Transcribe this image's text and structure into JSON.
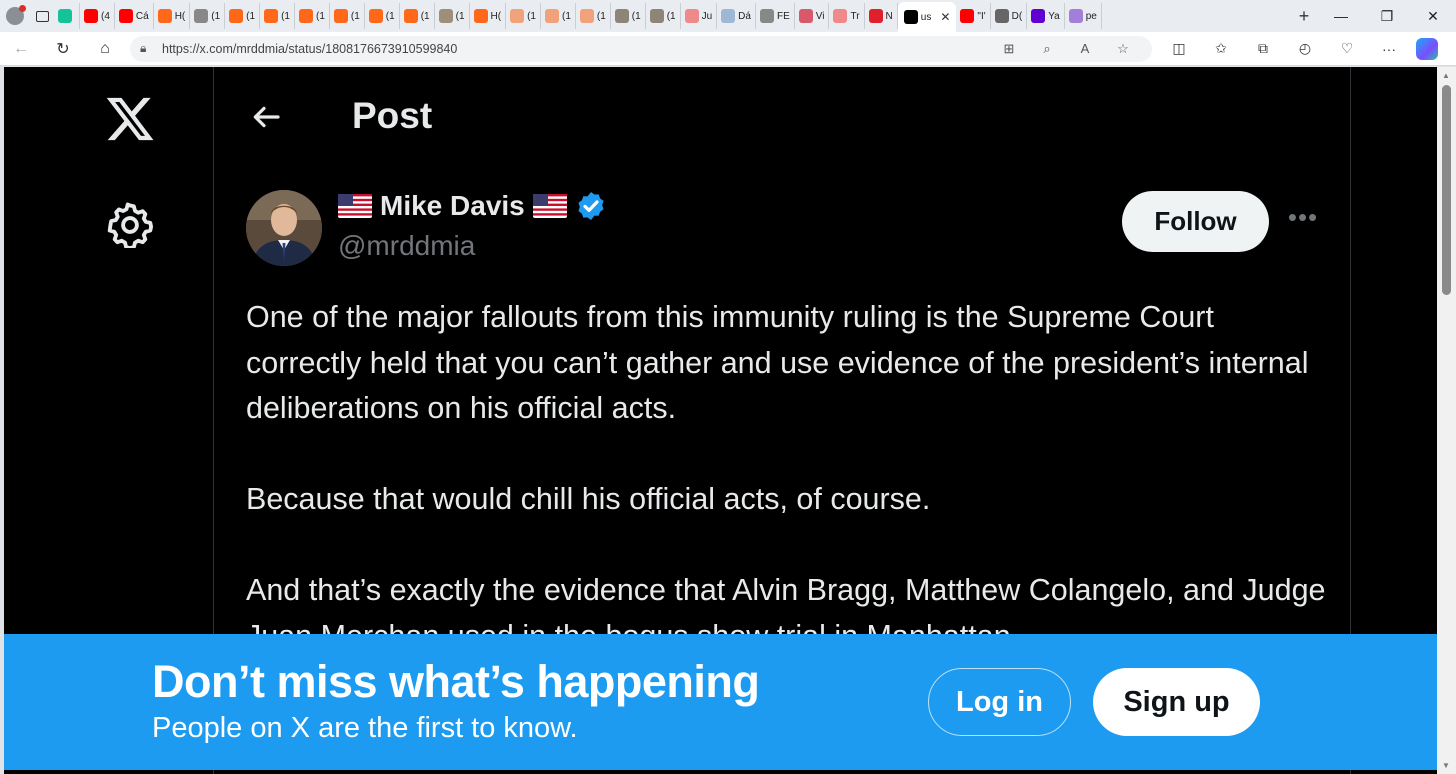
{
  "browser": {
    "tabs": [
      {
        "label": "",
        "icon": "grammarly-icon",
        "color": "#15c39a"
      },
      {
        "label": "(4",
        "icon": "youtube-icon",
        "color": "#ff0000"
      },
      {
        "label": "Cá",
        "icon": "youtube-icon",
        "color": "#ff0000"
      },
      {
        "label": "H(",
        "icon": "substack-icon",
        "color": "#ff6719"
      },
      {
        "label": "(1",
        "icon": "page-icon",
        "color": "#888888"
      },
      {
        "label": "(1",
        "icon": "substack-icon",
        "color": "#ff6719"
      },
      {
        "label": "(1",
        "icon": "substack-icon",
        "color": "#ff6719"
      },
      {
        "label": "(1",
        "icon": "substack-icon",
        "color": "#ff6719"
      },
      {
        "label": "(1",
        "icon": "substack-icon",
        "color": "#ff6719"
      },
      {
        "label": "(1",
        "icon": "substack-icon",
        "color": "#ff6719"
      },
      {
        "label": "(1",
        "icon": "substack-icon",
        "color": "#ff6719"
      },
      {
        "label": "(1",
        "icon": "image-icon",
        "color": "#9e8f7a"
      },
      {
        "label": "H(",
        "icon": "substack-icon",
        "color": "#ff6719"
      },
      {
        "label": "(1",
        "icon": "substack-icon",
        "color": "#f2a27a"
      },
      {
        "label": "(1",
        "icon": "substack-icon",
        "color": "#f2a27a"
      },
      {
        "label": "(1",
        "icon": "substack-icon",
        "color": "#f2a27a"
      },
      {
        "label": "(1",
        "icon": "image-icon",
        "color": "#8f8478"
      },
      {
        "label": "(1",
        "icon": "image-icon",
        "color": "#8f8478"
      },
      {
        "label": "Ju",
        "icon": "youtube-icon",
        "color": "#f08a8a"
      },
      {
        "label": "Dá",
        "icon": "pulse-icon",
        "color": "#9fb8d6"
      },
      {
        "label": "FE",
        "icon": "page-icon",
        "color": "#888888"
      },
      {
        "label": "Vi",
        "icon": "star-icon",
        "color": "#d85a6a"
      },
      {
        "label": "Tr",
        "icon": "youtube-icon",
        "color": "#f08a8a"
      },
      {
        "label": "N",
        "icon": "r-icon",
        "color": "#e0202a"
      },
      {
        "label": "us",
        "icon": "x-icon",
        "color": "#000000",
        "active": true
      },
      {
        "label": "\"I'",
        "icon": "youtube-icon",
        "color": "#ff0000"
      },
      {
        "label": "D(",
        "icon": "dd-icon",
        "color": "#666666"
      },
      {
        "label": "Ya",
        "icon": "yahoo-icon",
        "color": "#6001d2"
      },
      {
        "label": "pe",
        "icon": "yahoo-icon",
        "color": "#a27fd8"
      }
    ],
    "url": "https://x.com/mrddmia/status/1808176673910599840"
  },
  "nav": {
    "header_title": "Post"
  },
  "post": {
    "author_name": "Mike Davis",
    "handle": "@mrddmia",
    "follow_label": "Follow",
    "more_label": "•••",
    "paragraphs": [
      "One of the major fallouts from this immunity ruling is the Supreme Court correctly held that you can’t gather and use evidence of the president’s internal deliberations on his official acts.",
      "Because that would chill his official acts, of course.",
      "And that’s exactly the evidence that Alvin Bragg, Matthew Colangelo, and Judge Juan Merchan used in the bogus show trial in Manhattan."
    ]
  },
  "banner": {
    "title": "Don’t miss what’s happening",
    "subtitle": "People on X are the first to know.",
    "login_label": "Log in",
    "signup_label": "Sign up"
  },
  "colors": {
    "x_blue": "#1d9bf0",
    "background": "#000000",
    "text": "#e7e9ea",
    "muted": "#71767b"
  }
}
